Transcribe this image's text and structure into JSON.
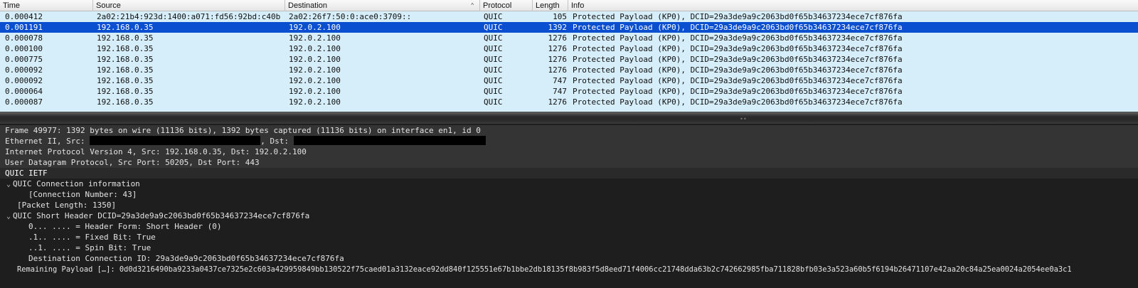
{
  "columns": {
    "time": "Time",
    "source": "Source",
    "destination": "Destination",
    "protocol": "Protocol",
    "length": "Length",
    "info": "Info"
  },
  "packets": [
    {
      "time": "0.000412",
      "source": "2a02:21b4:923d:1400:a071:fd56:92bd:c40b",
      "destination": "2a02:26f7:50:0:ace0:3709::",
      "protocol": "QUIC",
      "length": "105",
      "info": "Protected Payload (KP0), DCID=29a3de9a9c2063bd0f65b34637234ece7cf876fa"
    },
    {
      "time": "0.001191",
      "source": "192.168.0.35",
      "destination": "192.0.2.100",
      "protocol": "QUIC",
      "length": "1392",
      "info": "Protected Payload (KP0), DCID=29a3de9a9c2063bd0f65b34637234ece7cf876fa"
    },
    {
      "time": "0.000078",
      "source": "192.168.0.35",
      "destination": "192.0.2.100",
      "protocol": "QUIC",
      "length": "1276",
      "info": "Protected Payload (KP0), DCID=29a3de9a9c2063bd0f65b34637234ece7cf876fa"
    },
    {
      "time": "0.000100",
      "source": "192.168.0.35",
      "destination": "192.0.2.100",
      "protocol": "QUIC",
      "length": "1276",
      "info": "Protected Payload (KP0), DCID=29a3de9a9c2063bd0f65b34637234ece7cf876fa"
    },
    {
      "time": "0.000775",
      "source": "192.168.0.35",
      "destination": "192.0.2.100",
      "protocol": "QUIC",
      "length": "1276",
      "info": "Protected Payload (KP0), DCID=29a3de9a9c2063bd0f65b34637234ece7cf876fa"
    },
    {
      "time": "0.000092",
      "source": "192.168.0.35",
      "destination": "192.0.2.100",
      "protocol": "QUIC",
      "length": "1276",
      "info": "Protected Payload (KP0), DCID=29a3de9a9c2063bd0f65b34637234ece7cf876fa"
    },
    {
      "time": "0.000092",
      "source": "192.168.0.35",
      "destination": "192.0.2.100",
      "protocol": "QUIC",
      "length": "747",
      "info": "Protected Payload (KP0), DCID=29a3de9a9c2063bd0f65b34637234ece7cf876fa"
    },
    {
      "time": "0.000064",
      "source": "192.168.0.35",
      "destination": "192.0.2.100",
      "protocol": "QUIC",
      "length": "747",
      "info": "Protected Payload (KP0), DCID=29a3de9a9c2063bd0f65b34637234ece7cf876fa"
    },
    {
      "time": "0.000087",
      "source": "192.168.0.35",
      "destination": "192.0.2.100",
      "protocol": "QUIC",
      "length": "1276",
      "info": "Protected Payload (KP0), DCID=29a3de9a9c2063bd0f65b34637234ece7cf876fa"
    }
  ],
  "selected_row": 1,
  "sort_indicator": "^",
  "details": {
    "frame": "Frame 49977: 1392 bytes on wire (11136 bits), 1392 bytes captured (11136 bits) on interface en1, id 0",
    "ethernet_prefix": "Ethernet II, Src: ",
    "ethernet_mid": ", Dst: ",
    "ipv4": "Internet Protocol Version 4, Src: 192.168.0.35, Dst: 192.0.2.100",
    "udp": "User Datagram Protocol, Src Port: 50205, Dst Port: 443",
    "quic": "QUIC IETF",
    "conn_info": "QUIC Connection information",
    "conn_number": "[Connection Number: 43]",
    "packet_length": "[Packet Length: 1350]",
    "short_header": "QUIC Short Header DCID=29a3de9a9c2063bd0f65b34637234ece7cf876fa",
    "header_form": "0... .... = Header Form: Short Header (0)",
    "fixed_bit": ".1.. .... = Fixed Bit: True",
    "spin_bit": "..1. .... = Spin Bit: True",
    "dest_conn_id": "Destination Connection ID: 29a3de9a9c2063bd0f65b34637234ece7cf876fa",
    "remaining_payload": "Remaining Payload […]: 0d0d3216490ba9233a0437ce7325e2c603a429959849bb130522f75caed01a3132eace92dd840f125551e67b1bbe2db18135f8b983f5d8eed71f4006cc21748dda63b2c742662985fba711828bfb03e3a523a60b5f6194b26471107e42aa20c84a25ea0024a2054ee0a3c1"
  },
  "icons": {
    "expanded": "chevron-down-icon",
    "grip": "splitter-grip-icon"
  }
}
